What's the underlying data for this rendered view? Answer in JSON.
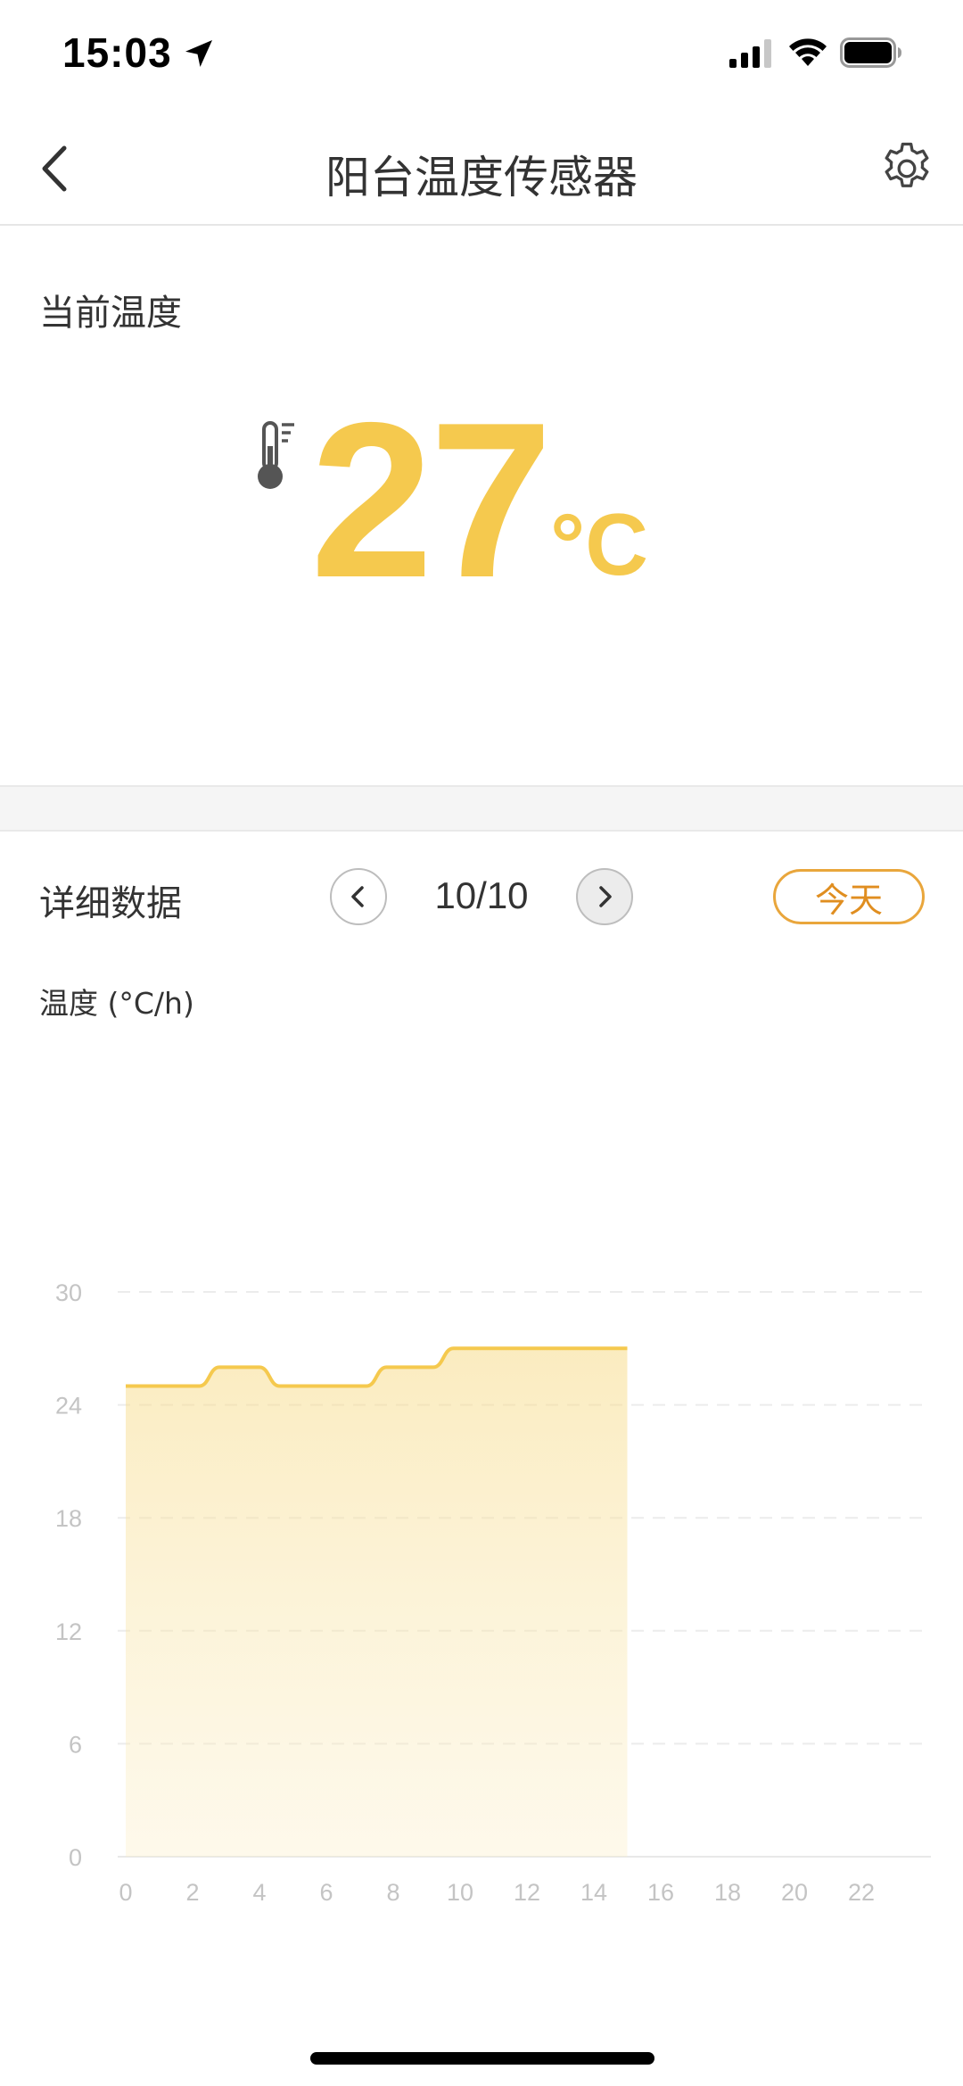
{
  "status_bar": {
    "time": "15:03"
  },
  "header": {
    "title": "阳台温度传感器"
  },
  "current": {
    "label": "当前温度",
    "value": "27",
    "unit": "°C"
  },
  "detail": {
    "label": "详细数据",
    "date": "10/10",
    "today_label": "今天"
  },
  "colors": {
    "accent": "#f5c94e",
    "today": "#e08e20"
  },
  "chart_data": {
    "type": "area",
    "ylabel": "温度 (°C/h)",
    "ylim": [
      0,
      30
    ],
    "yticks": [
      0,
      6,
      12,
      18,
      24,
      30
    ],
    "xlim": [
      0,
      24
    ],
    "xticks": [
      0,
      2,
      4,
      6,
      8,
      10,
      12,
      14,
      16,
      18,
      20,
      22
    ],
    "grid": true,
    "series": [
      {
        "x": [
          0,
          2.2,
          2.8,
          4.0,
          4.6,
          7.2,
          7.8,
          9.2,
          9.8,
          15.0
        ],
        "values": [
          25,
          25,
          26,
          26,
          25,
          25,
          26,
          26,
          27,
          27
        ]
      }
    ]
  }
}
